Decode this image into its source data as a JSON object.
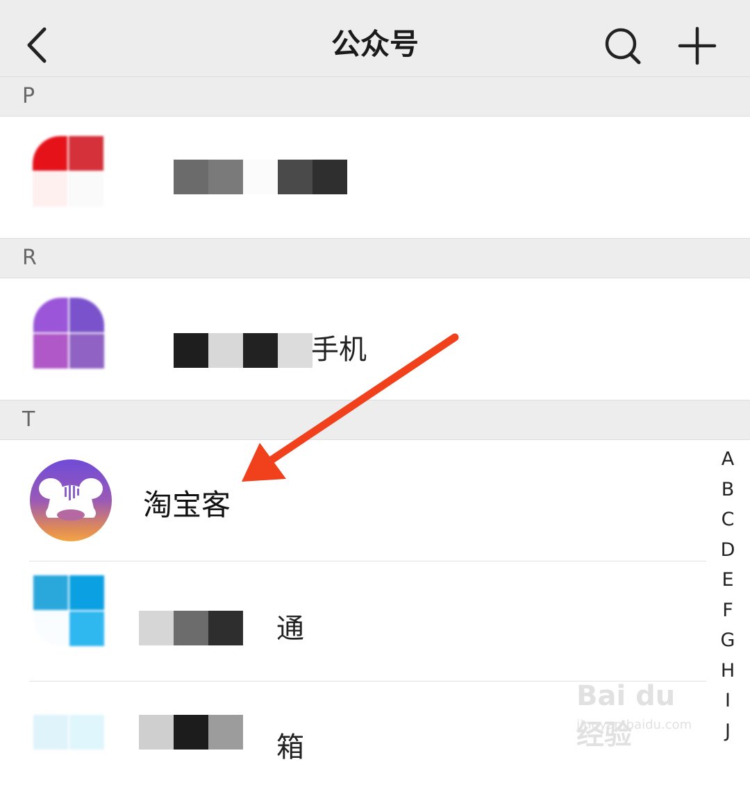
{
  "nav": {
    "title": "公众号"
  },
  "sections": [
    {
      "letter": "P"
    },
    {
      "letter": "R"
    },
    {
      "letter": "T"
    }
  ],
  "accounts": {
    "p_item": {
      "visible_suffix": ""
    },
    "r_item": {
      "visible_suffix": "手机"
    },
    "t_item1": {
      "name": "淘宝客"
    },
    "t_item2": {
      "visible_suffix": "通"
    },
    "t_item3": {
      "visible_suffix": "箱"
    }
  },
  "alphabet_index": [
    "A",
    "B",
    "C",
    "D",
    "E",
    "F",
    "G",
    "H",
    "I",
    "J"
  ],
  "watermark": {
    "brand": "Bai du 经验",
    "url": "jingyan.baidu.com"
  },
  "colors": {
    "arrow": "#f0401c",
    "nav_bg": "#ededed"
  }
}
